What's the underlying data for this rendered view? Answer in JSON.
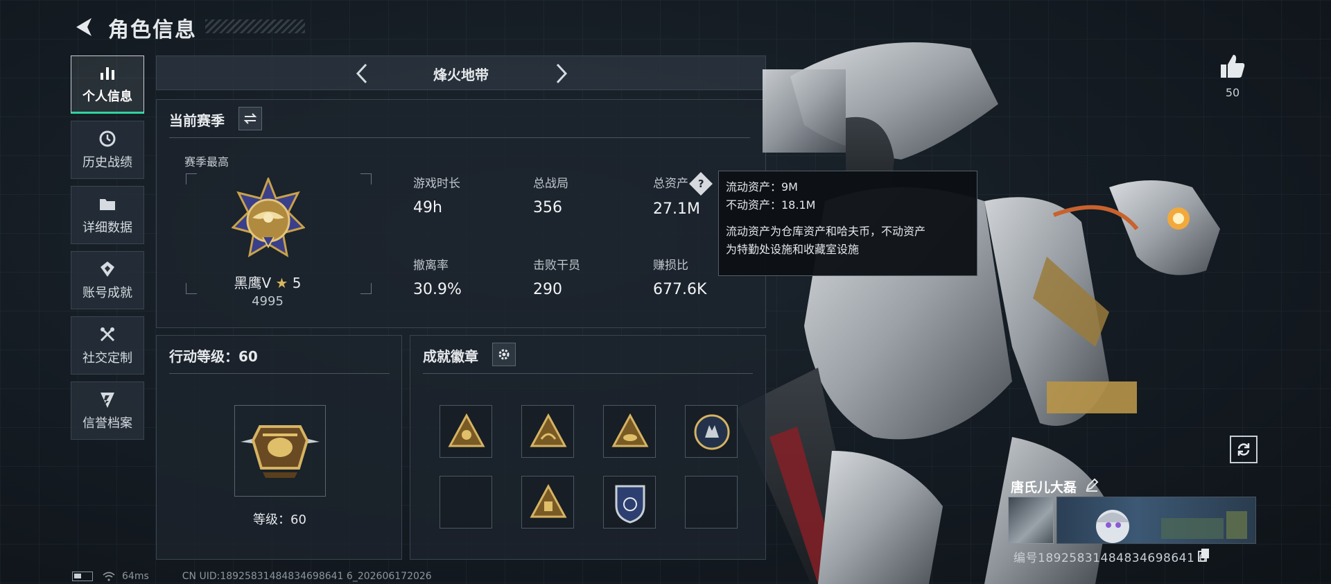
{
  "header": {
    "title": "角色信息"
  },
  "sidebar": {
    "items": [
      {
        "label": "个人信息",
        "icon": "bar-chart-icon",
        "active": true
      },
      {
        "label": "历史战绩",
        "icon": "clock-history-icon",
        "active": false
      },
      {
        "label": "详细数据",
        "icon": "folder-icon",
        "active": false
      },
      {
        "label": "账号成就",
        "icon": "achievement-icon",
        "active": false
      },
      {
        "label": "社交定制",
        "icon": "tools-icon",
        "active": false
      },
      {
        "label": "信誉档案",
        "icon": "reputation-shield-icon",
        "active": false
      }
    ]
  },
  "mode": {
    "title": "烽火地带"
  },
  "season": {
    "title": "当前赛季",
    "best_label": "赛季最高",
    "rank_name": "黑鹰V",
    "rank_stars": "5",
    "rank_score": "4995",
    "stats": [
      {
        "key": "游戏时长",
        "value": "49h"
      },
      {
        "key": "总战局",
        "value": "356"
      },
      {
        "key": "总资产",
        "value": "27.1M",
        "has_help": true
      },
      {
        "key": "撤离率",
        "value": "30.9%"
      },
      {
        "key": "击败干员",
        "value": "290"
      },
      {
        "key": "赚损比",
        "value": "677.6K"
      }
    ],
    "help_glyph": "?"
  },
  "tooltip": {
    "line1": "流动资产：9M",
    "line2": "不动资产：18.1M",
    "desc1": "流动资产为仓库资产和哈夫币，不动资产",
    "desc2": "为特勤处设施和收藏室设施"
  },
  "level": {
    "title": "行动等级：60",
    "label": "等级：60"
  },
  "badges": {
    "title": "成就徽章",
    "slots": [
      "gold-triangle-badge",
      "gold-triangle-badge",
      "gold-triangle-badge",
      "round-wolf-badge",
      "empty",
      "gold-triangle-badge",
      "blue-shield-badge",
      "empty"
    ]
  },
  "profile": {
    "likes": "50",
    "name": "唐氏儿大磊",
    "id_text": "编号18925831484834698641 6"
  },
  "footer": {
    "ping": "64ms",
    "uid": "CN UID:18925831484834698641 6_202606172026"
  },
  "colors": {
    "accent": "#2fd3a0",
    "gold": "#c9a24a",
    "panel": "#1c242d"
  }
}
